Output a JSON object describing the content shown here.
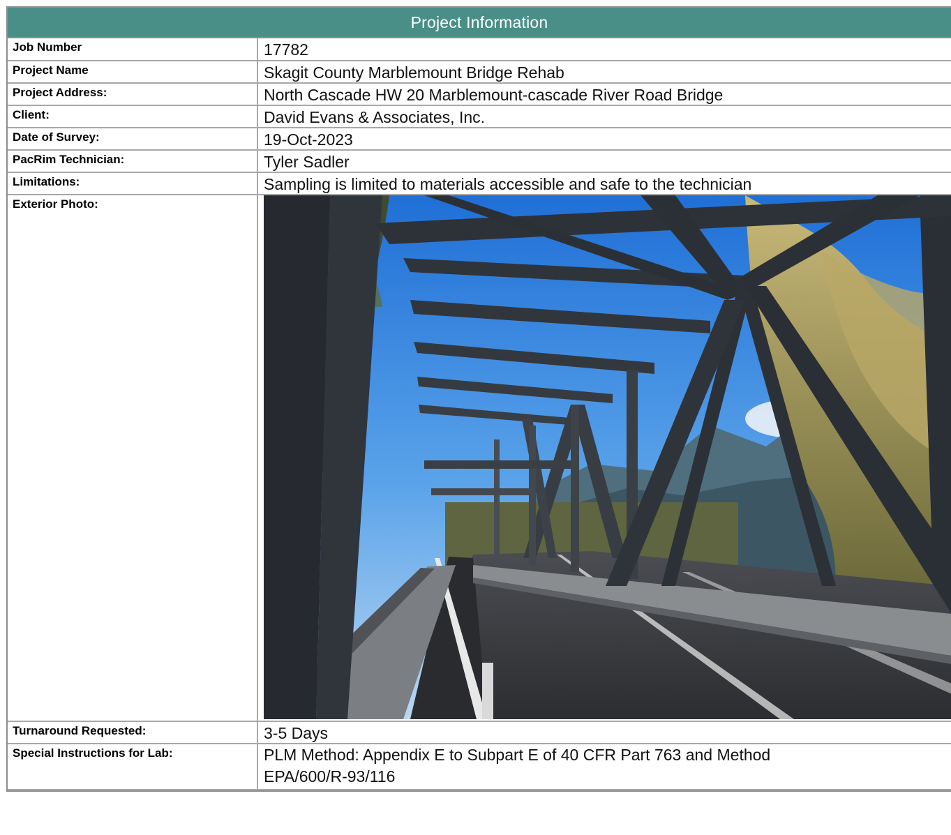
{
  "header": {
    "title": "Project Information"
  },
  "rows": {
    "job_number": {
      "label": "Job Number",
      "value": "17782"
    },
    "project_name": {
      "label": "Project Name",
      "value": "Skagit County Marblemount Bridge Rehab"
    },
    "project_address": {
      "label": "Project Address:",
      "value": "North Cascade HW 20 Marblemount-cascade River Road Bridge"
    },
    "client": {
      "label": "Client:",
      "value": "David Evans & Associates, Inc."
    },
    "date_of_survey": {
      "label": "Date of Survey:",
      "value": "19-Oct-2023"
    },
    "technician": {
      "label": "PacRim Technician:",
      "value": "Tyler Sadler"
    },
    "limitations": {
      "label": "Limitations:",
      "value": "Sampling is limited to materials accessible and safe to the technician"
    },
    "exterior_photo": {
      "label": "Exterior Photo:"
    },
    "turnaround": {
      "label": "Turnaround Requested:",
      "value": "3-5 Days"
    },
    "special_instructions": {
      "label": "Special Instructions for Lab:",
      "value_line1": "PLM Method: Appendix E to Subpart E of 40 CFR Part 763 and Method",
      "value_line2": "EPA/600/R-93/116"
    }
  },
  "colors": {
    "header_bg": "#4a8f87",
    "border": "#a8a8a8"
  }
}
